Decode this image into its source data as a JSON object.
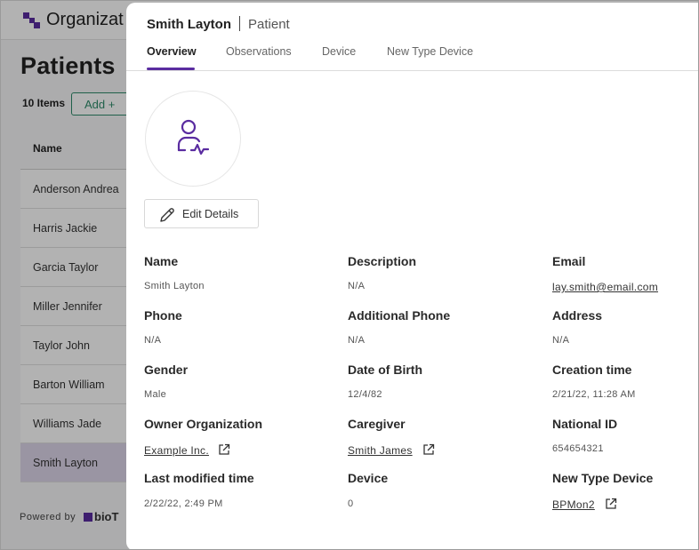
{
  "background": {
    "org_name": "Organizat",
    "page_title": "Patients",
    "item_count": "10 Items",
    "add_label": "Add +",
    "table_header_name": "Name",
    "rows": [
      "Anderson Andrea",
      "Harris Jackie",
      "Garcia Taylor",
      "Miller Jennifer",
      "Taylor John",
      "Barton William",
      "Williams Jade",
      "Smith Layton"
    ],
    "selected_row": "Smith Layton",
    "powered_by": "Powered by",
    "powered_logo": "bioT"
  },
  "drawer": {
    "name": "Smith Layton",
    "type": "Patient",
    "tabs": [
      "Overview",
      "Observations",
      "Device",
      "New Type Device"
    ],
    "active_tab": "Overview",
    "edit_label": "Edit Details"
  },
  "fields": {
    "name": {
      "label": "Name",
      "value": "Smith Layton"
    },
    "description": {
      "label": "Description",
      "value": "N/A"
    },
    "email": {
      "label": "Email",
      "value": "lay.smith@email.com"
    },
    "phone": {
      "label": "Phone",
      "value": "N/A"
    },
    "additional_phone": {
      "label": "Additional Phone",
      "value": "N/A"
    },
    "address": {
      "label": "Address",
      "value": "N/A"
    },
    "gender": {
      "label": "Gender",
      "value": "Male"
    },
    "date_of_birth": {
      "label": "Date of Birth",
      "value": "12/4/82"
    },
    "creation_time": {
      "label": "Creation time",
      "value": "2/21/22, 11:28 AM"
    },
    "owner_organization": {
      "label": "Owner Organization",
      "value": "Example Inc."
    },
    "caregiver": {
      "label": "Caregiver",
      "value": "Smith James"
    },
    "national_id": {
      "label": "National ID",
      "value": "654654321"
    },
    "last_modified_time": {
      "label": "Last modified time",
      "value": "2/22/22, 2:49 PM"
    },
    "device": {
      "label": "Device",
      "value": "0"
    },
    "new_type_device": {
      "label": "New Type Device",
      "value": "BPMon2"
    }
  },
  "colors": {
    "accent": "#5a2ca0",
    "add_button": "#2e8b6a",
    "selected_row": "#ddd6ea"
  }
}
